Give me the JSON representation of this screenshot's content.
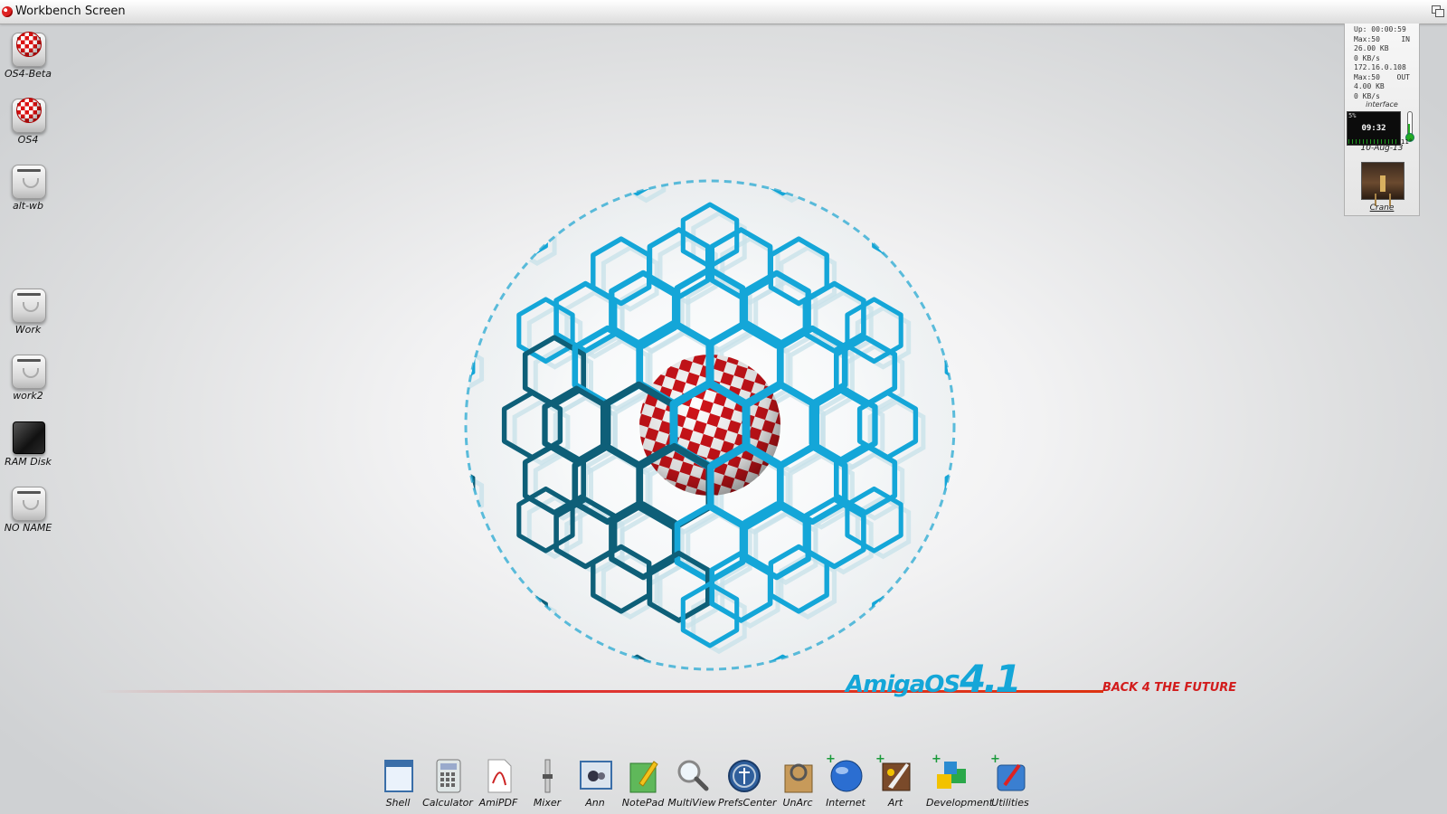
{
  "screen": {
    "title": "Workbench Screen"
  },
  "desktop_icons": [
    {
      "label": "OS4-Beta",
      "kind": "boing-drive"
    },
    {
      "label": "OS4",
      "kind": "boing-drive"
    },
    {
      "label": "alt-wb",
      "kind": "hard-drive"
    },
    {
      "label": "Work",
      "kind": "hard-drive"
    },
    {
      "label": "work2",
      "kind": "hard-drive"
    },
    {
      "label": "RAM Disk",
      "kind": "ram-disk"
    },
    {
      "label": "NO NAME",
      "kind": "hard-drive"
    }
  ],
  "network": {
    "lines": [
      "Up: 00:00:59",
      "Max:50",
      "26.00 KB",
      "0 KB/s",
      "172.16.0.108",
      "Max:50",
      "4.00 KB",
      "0 KB/s"
    ],
    "in_label": "IN",
    "out_label": "OUT",
    "interface_label": "interface"
  },
  "clock": {
    "cpu_percent": "5%",
    "time": "09:32",
    "date": "10-Aug-13",
    "temperature": "11°"
  },
  "crane": {
    "label": "Crane"
  },
  "logo": {
    "amiga": "AmigaOS",
    "version": "4.1",
    "tagline": "BACK 4 THE FUTURE"
  },
  "dock": [
    {
      "label": "Shell",
      "icon": "shell-icon"
    },
    {
      "label": "Calculator",
      "icon": "calculator-icon"
    },
    {
      "label": "AmiPDF",
      "icon": "pdf-icon"
    },
    {
      "label": "Mixer",
      "icon": "mixer-icon"
    },
    {
      "label": "Ann",
      "icon": "ann-icon"
    },
    {
      "label": "NotePad",
      "icon": "notepad-icon"
    },
    {
      "label": "MultiView",
      "icon": "magnifier-icon"
    },
    {
      "label": "PrefsCenter",
      "icon": "prefs-icon"
    },
    {
      "label": "UnArc",
      "icon": "unarc-icon"
    },
    {
      "label": "Internet",
      "icon": "globe-icon"
    },
    {
      "label": "Art",
      "icon": "art-icon"
    },
    {
      "label": "Development",
      "icon": "cubes-icon"
    },
    {
      "label": "Utilities",
      "icon": "utilities-icon"
    }
  ],
  "colors": {
    "accent_blue": "#14a6d8",
    "accent_red": "#d21c1c",
    "hex_dark": "#0e5f78"
  }
}
